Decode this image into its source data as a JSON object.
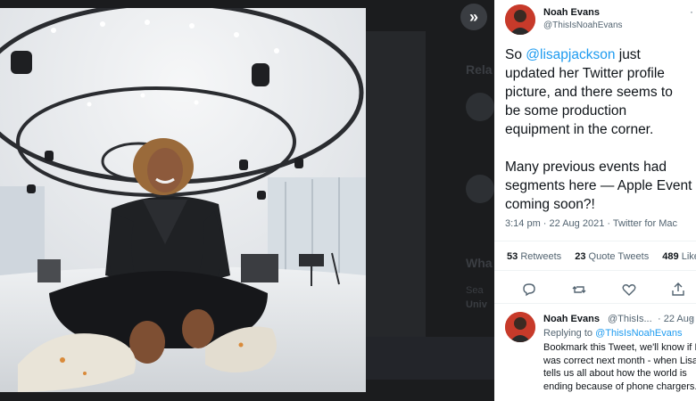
{
  "backdrop": {
    "related_label": "Rela",
    "what_label": "Wha",
    "row1": "Sea",
    "row2": "Univ"
  },
  "expand_button": {
    "icon": "chevron-double-right-icon",
    "label": "»"
  },
  "tweet": {
    "author_name": "Noah Evans",
    "author_handle": "@ThisIsNoahEvans",
    "more": "·",
    "text_lines": {
      "l1_pre": "So ",
      "l1_mention": "@lisapjackson",
      "l1_post": " just",
      "l2": "updated her Twitter profile",
      "l3": "picture, and there seems to",
      "l4": "be some production",
      "l5": "equipment in the corner.",
      "l7": "Many previous events had",
      "l8": "segments here — Apple Event",
      "l9": "coming soon?!"
    },
    "timestamp": "3:14 pm · 22 Aug 2021 · Twitter for Mac",
    "stats": {
      "retweets_count": "53",
      "retweets_label": "Retweets",
      "quotes_count": "23",
      "quotes_label": "Quote Tweets",
      "likes_count": "489",
      "likes_label": "Like"
    },
    "actions": [
      "reply-icon",
      "retweet-icon",
      "like-icon",
      "share-icon"
    ]
  },
  "reply": {
    "author_name": "Noah Evans",
    "author_handle": "@ThisIs...",
    "date": "· 22 Aug",
    "more": "·",
    "replying_prefix": "Replying to ",
    "replying_handle": "@ThisIsNoahEvans",
    "text_lines": [
      "Bookmark this Tweet, we'll know if I",
      "was correct next month - when Lisa",
      "tells us all about how the world is",
      "ending because of phone chargers."
    ]
  },
  "colors": {
    "accent": "#1d9bf0",
    "text": "#0f1419",
    "muted": "#536471",
    "backdrop": "#1b1c1e"
  }
}
